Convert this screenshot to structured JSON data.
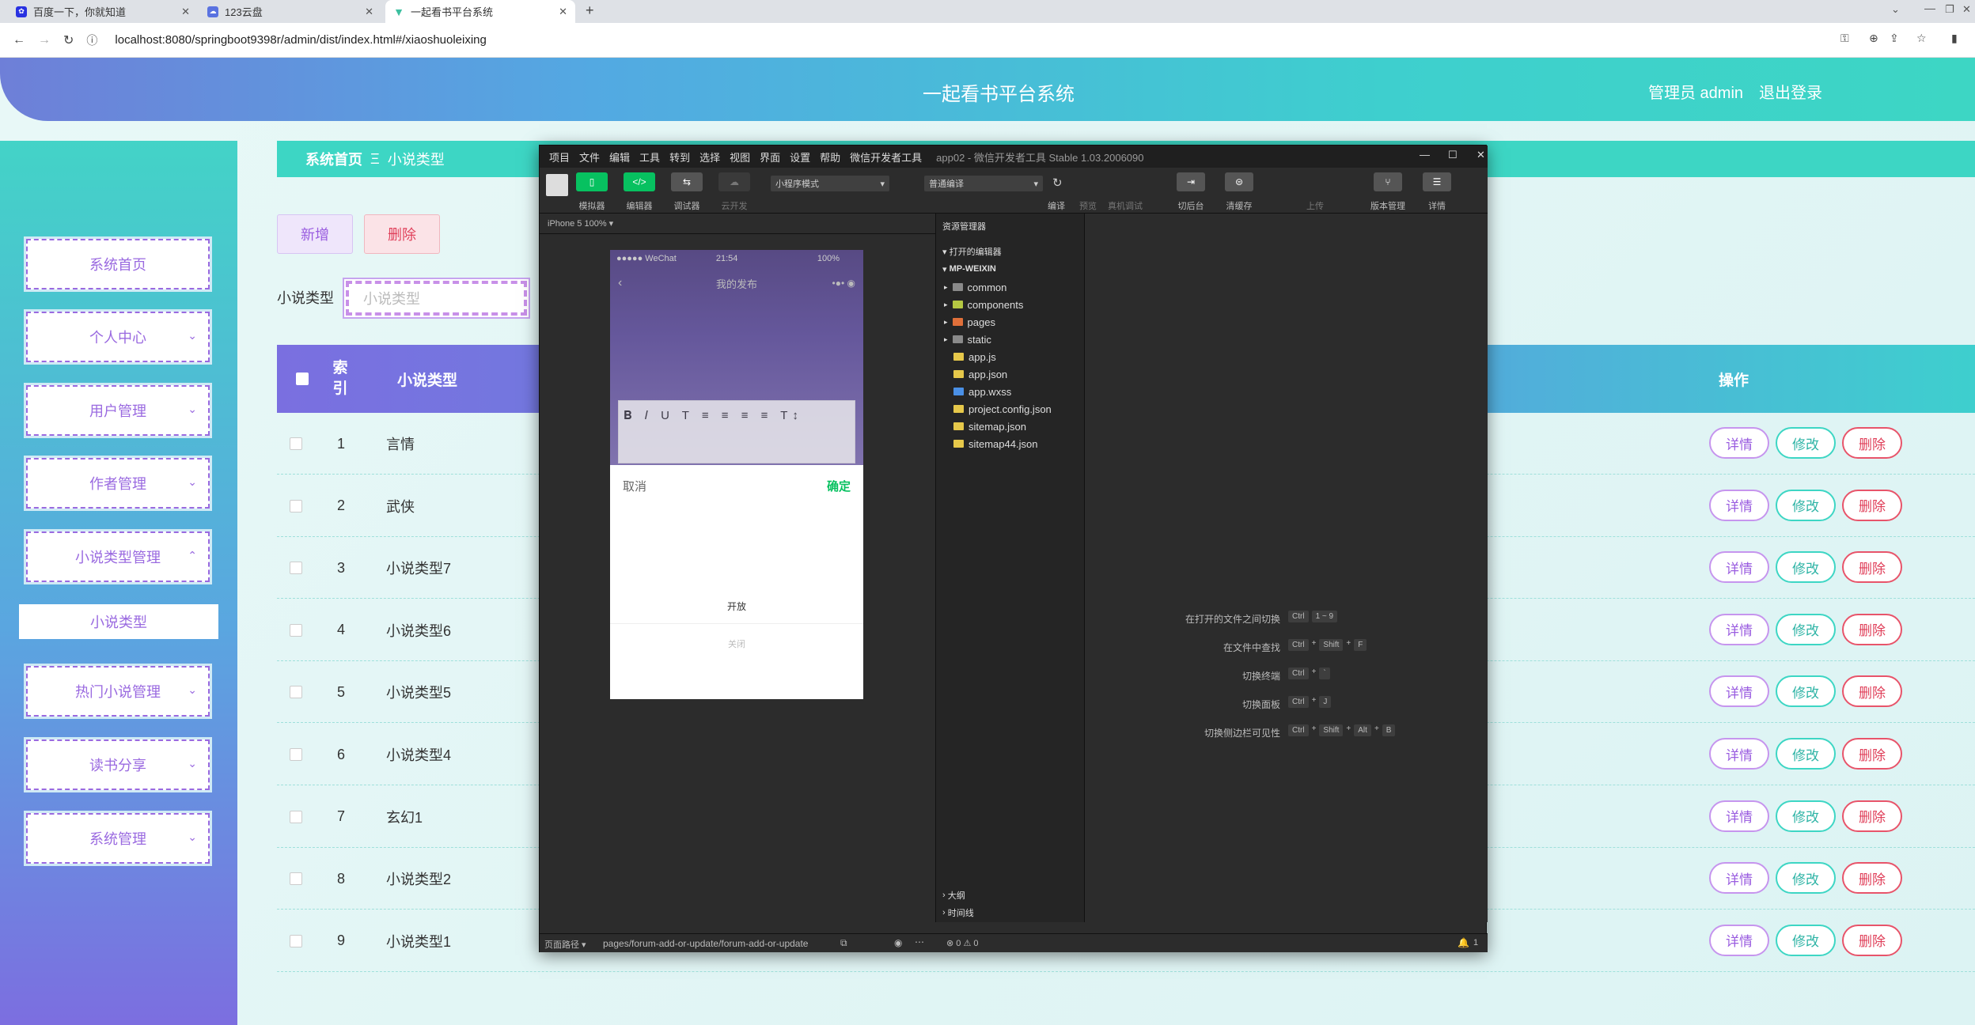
{
  "browser": {
    "tabs": [
      {
        "title": "百度一下，你就知道"
      },
      {
        "title": "123云盘"
      },
      {
        "title": "一起看书平台系统"
      }
    ],
    "url": "localhost:8080/springboot9398r/admin/dist/index.html#/xiaoshuoleixing"
  },
  "header": {
    "title": "一起看书平台系统",
    "user": "管理员 admin",
    "logout": "退出登录"
  },
  "sidebar": {
    "items": [
      {
        "label": "系统首页",
        "has_chevron": false
      },
      {
        "label": "个人中心",
        "has_chevron": true
      },
      {
        "label": "用户管理",
        "has_chevron": true
      },
      {
        "label": "作者管理",
        "has_chevron": true
      },
      {
        "label": "小说类型管理",
        "has_chevron": true
      },
      {
        "label": "小说类型",
        "sub": true
      },
      {
        "label": "热门小说管理",
        "has_chevron": true
      },
      {
        "label": "读书分享",
        "has_chevron": true
      },
      {
        "label": "系统管理",
        "has_chevron": true
      }
    ]
  },
  "breadcrumb": {
    "home": "系统首页",
    "separator": "Ξ",
    "current": "小说类型"
  },
  "toolbar": {
    "add": "新增",
    "delete": "删除"
  },
  "filter": {
    "label": "小说类型",
    "placeholder": "小说类型"
  },
  "table": {
    "headers": {
      "index": "索引",
      "type": "小说类型",
      "actions": "操作"
    },
    "rows": [
      {
        "index": "1",
        "type": "言情"
      },
      {
        "index": "2",
        "type": "武侠"
      },
      {
        "index": "3",
        "type": "小说类型7"
      },
      {
        "index": "4",
        "type": "小说类型6"
      },
      {
        "index": "5",
        "type": "小说类型5"
      },
      {
        "index": "6",
        "type": "小说类型4"
      },
      {
        "index": "7",
        "type": "玄幻1"
      },
      {
        "index": "8",
        "type": "小说类型2"
      },
      {
        "index": "9",
        "type": "小说类型1"
      }
    ],
    "row_buttons": {
      "detail": "详情",
      "edit": "修改",
      "delete": "删除"
    }
  },
  "devtools": {
    "menu": [
      "项目",
      "文件",
      "编辑",
      "工具",
      "转到",
      "选择",
      "视图",
      "界面",
      "设置",
      "帮助",
      "微信开发者工具"
    ],
    "title": "app02 - 微信开发者工具 Stable 1.03.2006090",
    "tools": [
      {
        "label": "模拟器"
      },
      {
        "label": "编辑器"
      },
      {
        "label": "调试器"
      },
      {
        "label": "云开发"
      }
    ],
    "mode_select": "小程序模式",
    "compile_select": "普通编译",
    "right_tools": [
      "编译",
      "预览",
      "真机调试",
      "切后台",
      "清缓存",
      "上传",
      "版本管理",
      "详情"
    ],
    "sim_device": "iPhone 5 100% ▾",
    "phone": {
      "carrier": "●●●●● WeChat",
      "time": "21:54",
      "battery": "100%",
      "nav_title": "我的发布",
      "cancel": "取消",
      "confirm": "确定",
      "option_open": "开放",
      "option_close": "关闭"
    },
    "explorer": {
      "title": "资源管理器",
      "open_editors": "打开的编辑器",
      "project": "MP-WEIXIN",
      "files": [
        {
          "name": "common",
          "kind": "folder"
        },
        {
          "name": "components",
          "kind": "folder"
        },
        {
          "name": "pages",
          "kind": "folder"
        },
        {
          "name": "static",
          "kind": "folder"
        },
        {
          "name": "app.js",
          "kind": "js"
        },
        {
          "name": "app.json",
          "kind": "json"
        },
        {
          "name": "app.wxss",
          "kind": "wxss"
        },
        {
          "name": "project.config.json",
          "kind": "json"
        },
        {
          "name": "sitemap.json",
          "kind": "json"
        },
        {
          "name": "sitemap44.json",
          "kind": "json"
        }
      ],
      "outline": "大纲",
      "timeline": "时间线"
    },
    "shortcuts": [
      {
        "label": "在打开的文件之间切换",
        "keys": [
          "Ctrl",
          "1 ~ 9"
        ]
      },
      {
        "label": "在文件中查找",
        "keys": [
          "Ctrl",
          "+",
          "Shift",
          "+",
          "F"
        ]
      },
      {
        "label": "切换终端",
        "keys": [
          "Ctrl",
          "+",
          "`"
        ]
      },
      {
        "label": "切换面板",
        "keys": [
          "Ctrl",
          "+",
          "J"
        ]
      },
      {
        "label": "切换侧边栏可见性",
        "keys": [
          "Ctrl",
          "+",
          "Shift",
          "+",
          "Alt",
          "+",
          "B"
        ]
      }
    ],
    "status_path_label": "页面路径 ▾",
    "status_path": "pages/forum-add-or-update/forum-add-or-update",
    "status_errors": "⊗ 0 ⚠ 0",
    "status_bell": "1"
  }
}
